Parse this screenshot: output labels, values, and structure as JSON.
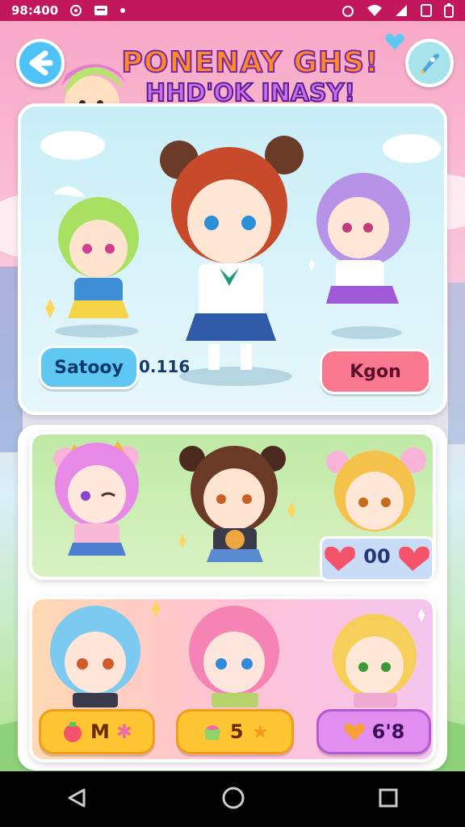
{
  "status": {
    "time": "98:400"
  },
  "header": {
    "title_line1": "PONENAY GHS!",
    "title_line2": "HHD'OK INASY!"
  },
  "featured": {
    "left_button": "Satooy",
    "left_value": "0.116",
    "right_button": "Kgon"
  },
  "middle_row": {
    "counter": "00"
  },
  "bottom_row": {
    "badges": [
      {
        "value": "M",
        "icon": "strawberry-icon"
      },
      {
        "value": "5",
        "icon": "cake-icon"
      },
      {
        "value": "6'8",
        "icon": "heart-icon"
      }
    ]
  },
  "colors": {
    "status_bar": "#c2185b",
    "back_button": "#4fc3f7",
    "blue_pill": "#5ec8f2",
    "pink_pill": "#f9788f",
    "yellow_badge": "#ffc533",
    "purple_badge": "#e28ef0"
  }
}
